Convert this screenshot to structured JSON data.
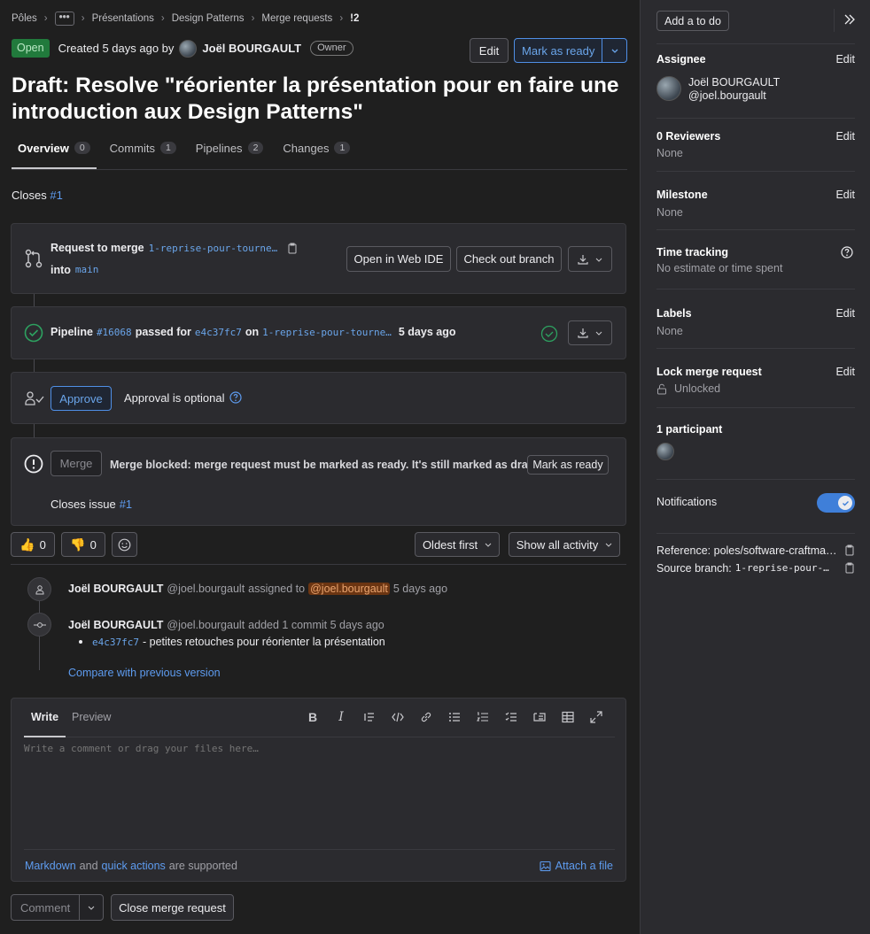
{
  "breadcrumbs": [
    "Pôles",
    "•••",
    "Présentations",
    "Design Patterns",
    "Merge requests",
    "!2"
  ],
  "header": {
    "status": "Open",
    "created": "Created 5 days ago by",
    "author": "Joël BOURGAULT",
    "role": "Owner",
    "edit_label": "Edit",
    "mark_ready_label": "Mark as ready"
  },
  "title": "Draft: Resolve \"réorienter la présentation pour en faire une introduction aux Design Patterns\"",
  "tabs": [
    {
      "label": "Overview",
      "count": "0"
    },
    {
      "label": "Commits",
      "count": "1"
    },
    {
      "label": "Pipelines",
      "count": "2"
    },
    {
      "label": "Changes",
      "count": "1"
    }
  ],
  "closes": {
    "text": "Closes",
    "ref": "#1"
  },
  "merge_request": {
    "request_text": "Request to merge",
    "source_branch": "1-reprise-pour-tourne…",
    "into_text": "into",
    "target_branch": "main",
    "open_ide": "Open in Web IDE",
    "checkout": "Check out branch"
  },
  "pipeline": {
    "label": "Pipeline",
    "id": "#16068",
    "passed_for": "passed for",
    "commit": "e4c37fc7",
    "on": "on",
    "branch": "1-reprise-pour-tourne…",
    "time": "5 days ago"
  },
  "approval": {
    "button": "Approve",
    "text": "Approval is optional"
  },
  "merge": {
    "button": "Merge",
    "blocked": "Merge blocked: merge request must be marked as ready. It's still marked as draft.",
    "mark_ready": "Mark as ready",
    "closes_issue": "Closes issue",
    "issue_ref": "#1"
  },
  "reactions": {
    "thumbs_up": "0",
    "thumbs_down": "0"
  },
  "activity": {
    "sort": "Oldest first",
    "filter": "Show all activity"
  },
  "events": [
    {
      "author": "Joël BOURGAULT",
      "handle": "@joel.bourgault",
      "action": "assigned to",
      "mention": "@joel.bourgault",
      "time": "5 days ago"
    },
    {
      "author": "Joël BOURGAULT",
      "handle": "@joel.bourgault",
      "action": "added 1 commit 5 days ago",
      "commit": "e4c37fc7",
      "commit_msg": "- petites retouches pour réorienter la présentation",
      "compare": "Compare with previous version"
    }
  ],
  "comment_box": {
    "write_tab": "Write",
    "preview_tab": "Preview",
    "placeholder": "Write a comment or drag your files here…",
    "markdown": "Markdown",
    "and": "and",
    "quick_actions": "quick actions",
    "supported": "are supported",
    "attach": "Attach a file"
  },
  "footer": {
    "comment": "Comment",
    "close_mr": "Close merge request"
  },
  "sidebar": {
    "todo": "Add a to do",
    "assignee": {
      "title": "Assignee",
      "edit": "Edit",
      "name": "Joël BOURGAULT",
      "handle": "@joel.bourgault"
    },
    "reviewers": {
      "title": "0 Reviewers",
      "edit": "Edit",
      "value": "None"
    },
    "milestone": {
      "title": "Milestone",
      "edit": "Edit",
      "value": "None"
    },
    "time_tracking": {
      "title": "Time tracking",
      "value": "No estimate or time spent"
    },
    "labels": {
      "title": "Labels",
      "edit": "Edit",
      "value": "None"
    },
    "lock": {
      "title": "Lock merge request",
      "edit": "Edit",
      "value": "Unlocked"
    },
    "participants": {
      "title": "1 participant"
    },
    "notifications": {
      "title": "Notifications",
      "enabled": true
    },
    "reference": "Reference: poles/software-craftma…",
    "source_branch_label": "Source branch:",
    "source_branch": "1-reprise-pour-…"
  },
  "colors": {
    "accent": "#4f8fe6",
    "success": "#2da160",
    "open_badge": "#217a3c"
  }
}
